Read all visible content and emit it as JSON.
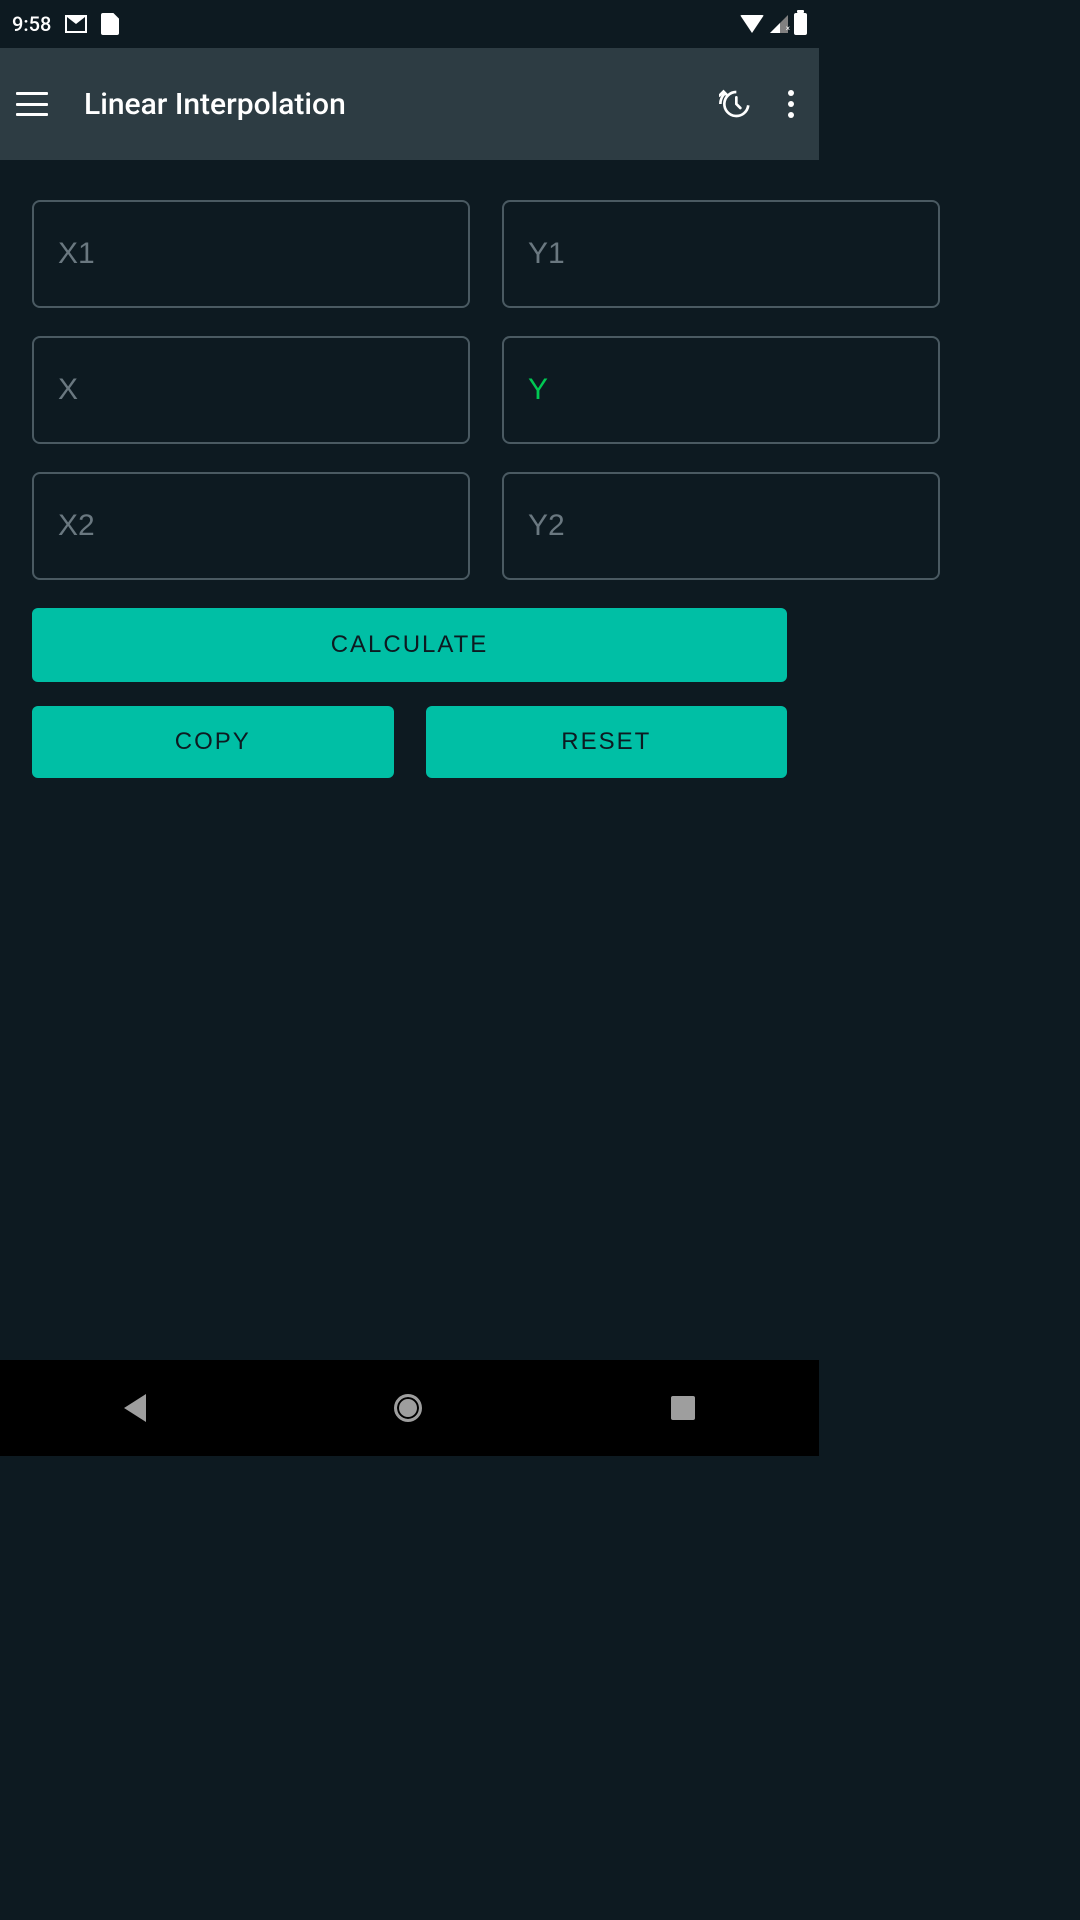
{
  "status": {
    "time": "9:58"
  },
  "appbar": {
    "title": "Linear Interpolation"
  },
  "inputs": {
    "x1": {
      "placeholder": "X1",
      "value": ""
    },
    "y1": {
      "placeholder": "Y1",
      "value": ""
    },
    "x": {
      "placeholder": "X",
      "value": ""
    },
    "y": {
      "placeholder": "Y",
      "value": ""
    },
    "x2": {
      "placeholder": "X2",
      "value": ""
    },
    "y2": {
      "placeholder": "Y2",
      "value": ""
    }
  },
  "buttons": {
    "calculate": "CALCULATE",
    "copy": "COPY",
    "reset": "RESET"
  },
  "colors": {
    "accent": "#00bfa5",
    "result": "#00c853",
    "background": "#0d1a21",
    "appbar": "#2d3c43",
    "border": "#4a5a62"
  }
}
